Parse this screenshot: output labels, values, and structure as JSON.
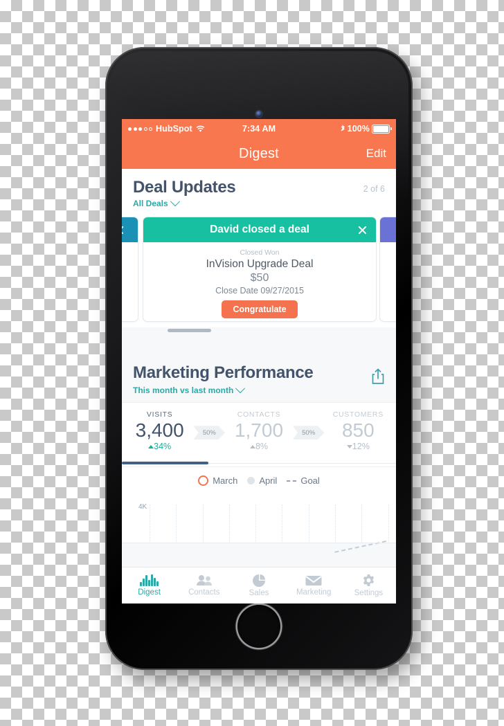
{
  "status_bar": {
    "carrier": "HubSpot",
    "time": "7:34 AM",
    "battery_pct": "100%",
    "signal_dots_filled": 3,
    "signal_dots_total": 5,
    "wifi_icon": "wifi-icon",
    "bluetooth_icon": "bluetooth-icon"
  },
  "nav": {
    "title": "Digest",
    "edit": "Edit"
  },
  "deal_updates": {
    "title": "Deal Updates",
    "filter": "All Deals",
    "counter": "2 of 6",
    "card": {
      "header": "David closed a deal",
      "stage": "Closed Won",
      "name": "InVision Upgrade Deal",
      "amount": "$50",
      "close_date": "Close Date 09/27/2015",
      "cta": "Congratulate",
      "header_color": "#16c0a0",
      "cta_color": "#f4734e"
    },
    "side_card_left_color": "#1b92b5",
    "side_card_right_color": "#6b72d6"
  },
  "marketing": {
    "title": "Marketing Performance",
    "period": "This month vs last month",
    "share_icon": "share-icon",
    "metrics": [
      {
        "label": "VISITS",
        "value": "3,400",
        "delta": "34%",
        "direction": "up"
      },
      {
        "label": "CONTACTS",
        "value": "1,700",
        "delta": "8%",
        "direction": "up"
      },
      {
        "label": "CUSTOMERS",
        "value": "850",
        "delta": "12%",
        "direction": "down"
      }
    ],
    "conversions": [
      "50%",
      "50%"
    ]
  },
  "chart_data": {
    "type": "line",
    "title": "Marketing Performance",
    "xlabel": "",
    "ylabel": "",
    "ytick_labels": [
      "4K"
    ],
    "ylim": [
      0,
      4000
    ],
    "grid": true,
    "legend_position": "top",
    "series": [
      {
        "name": "March",
        "color": "#f4734e",
        "marker": "open-circle",
        "values": []
      },
      {
        "name": "April",
        "color": "#dfe4e9",
        "marker": "filled-circle",
        "values": []
      },
      {
        "name": "Goal",
        "color": "#9aa5b1",
        "style": "dashed",
        "values": []
      }
    ]
  },
  "tabbar": [
    {
      "label": "Digest",
      "icon": "waveform-icon",
      "active": true
    },
    {
      "label": "Contacts",
      "icon": "people-icon",
      "active": false
    },
    {
      "label": "Sales",
      "icon": "pie-chart-icon",
      "active": false
    },
    {
      "label": "Marketing",
      "icon": "envelope-icon",
      "active": false
    },
    {
      "label": "Settings",
      "icon": "gear-icon",
      "active": false
    }
  ]
}
